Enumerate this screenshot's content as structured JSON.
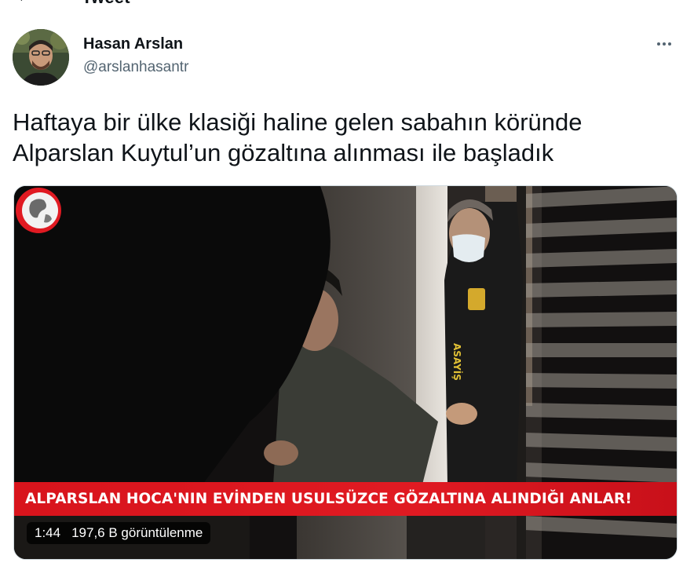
{
  "header": {
    "title": "Tweet"
  },
  "author": {
    "name": "Hasan Arslan",
    "handle": "@arslanhasantr"
  },
  "tweet": {
    "text_line1": "Haftaya bir ülke klasiği haline gelen sabahın köründe",
    "text_line2": "Alparslan Kuytul’un gözaltına alınması ile başladık"
  },
  "video": {
    "banner": "ALPARSLAN HOCA'NIN EVİNDEN USULSÜZCE GÖZALTINA ALINDIĞI ANLAR!",
    "vest_text": "ASAYİŞ",
    "duration": "1:44",
    "views": "197,6 B görüntülenme"
  },
  "colors": {
    "banner": "#e01a22",
    "handle": "#536471",
    "text": "#0f1419"
  }
}
